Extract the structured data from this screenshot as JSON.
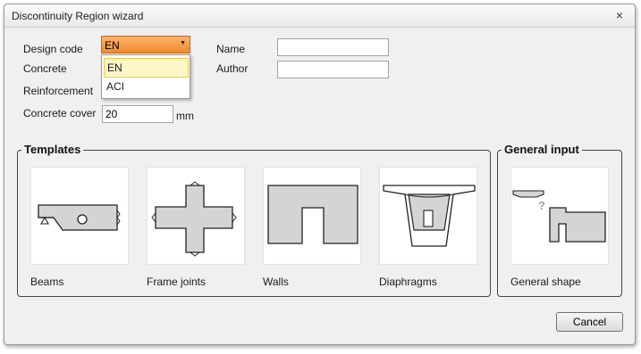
{
  "window": {
    "title": "Discontinuity Region wizard",
    "close_glyph": "×"
  },
  "form": {
    "design_code_label": "Design code",
    "design_code_value": "EN",
    "design_code_options": [
      "EN",
      "ACI"
    ],
    "concrete_label": "Concrete",
    "reinforcement_label": "Reinforcement",
    "concrete_cover_label": "Concrete cover",
    "concrete_cover_value": "20",
    "concrete_cover_unit": "mm",
    "name_label": "Name",
    "name_value": "",
    "author_label": "Author",
    "author_value": ""
  },
  "templates": {
    "title": "Templates",
    "items": [
      {
        "label": "Beams",
        "icon": "beam-icon"
      },
      {
        "label": "Frame joints",
        "icon": "frame-joint-icon"
      },
      {
        "label": "Walls",
        "icon": "wall-icon"
      },
      {
        "label": "Diaphragms",
        "icon": "diaphragm-icon"
      }
    ]
  },
  "general_input": {
    "title": "General input",
    "items": [
      {
        "label": "General shape",
        "icon": "general-shape-icon"
      }
    ]
  },
  "footer": {
    "cancel_label": "Cancel"
  },
  "colors": {
    "combo_highlight": "#f08a2e",
    "dropdown_selected": "#fff6c8",
    "shape_fill": "#d4d4d4"
  }
}
